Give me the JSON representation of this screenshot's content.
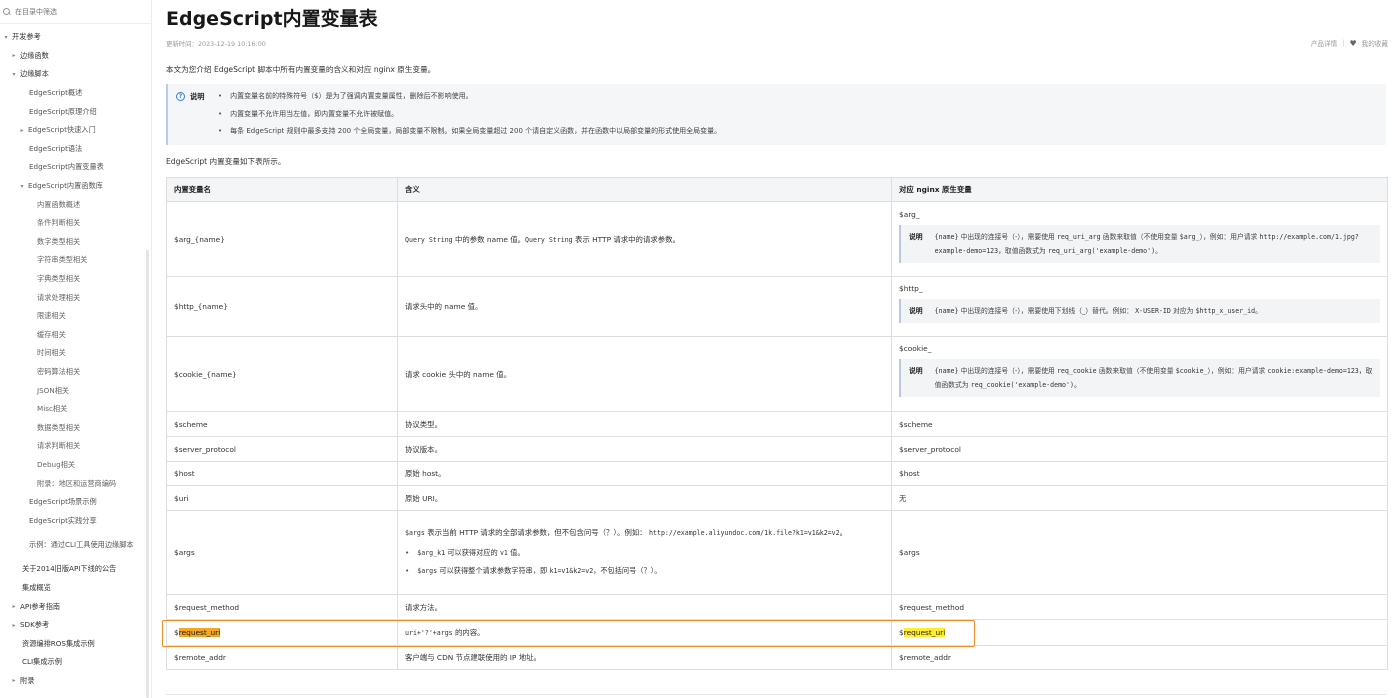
{
  "sidebar": {
    "search_placeholder": "在目录中筛选",
    "items": [
      {
        "label": "开发参考",
        "toggle": "▾"
      },
      {
        "label": "边缘函数",
        "toggle": "▸"
      },
      {
        "label": "边缘脚本",
        "toggle": "▾"
      },
      {
        "label": "EdgeScript概述",
        "toggle": ""
      },
      {
        "label": "EdgeScript原理介绍",
        "toggle": ""
      },
      {
        "label": "EdgeScript快速入门",
        "toggle": "▸"
      },
      {
        "label": "EdgeScript语法",
        "toggle": ""
      },
      {
        "label": "EdgeScript内置变量表",
        "toggle": ""
      },
      {
        "label": "EdgeScript内置函数库",
        "toggle": "▾"
      },
      {
        "label": "内置函数概述",
        "toggle": ""
      },
      {
        "label": "条件判断相关",
        "toggle": ""
      },
      {
        "label": "数字类型相关",
        "toggle": ""
      },
      {
        "label": "字符串类型相关",
        "toggle": ""
      },
      {
        "label": "字典类型相关",
        "toggle": ""
      },
      {
        "label": "请求处理相关",
        "toggle": ""
      },
      {
        "label": "限速相关",
        "toggle": ""
      },
      {
        "label": "缓存相关",
        "toggle": ""
      },
      {
        "label": "时间相关",
        "toggle": ""
      },
      {
        "label": "密码算法相关",
        "toggle": ""
      },
      {
        "label": "JSON相关",
        "toggle": ""
      },
      {
        "label": "Misc相关",
        "toggle": ""
      },
      {
        "label": "数据类型相关",
        "toggle": ""
      },
      {
        "label": "请求判断相关",
        "toggle": ""
      },
      {
        "label": "Debug相关",
        "toggle": ""
      },
      {
        "label": "附录：地区和运营商编码",
        "toggle": ""
      },
      {
        "label": "EdgeScript场景示例",
        "toggle": ""
      },
      {
        "label": "EdgeScript实践分享",
        "toggle": ""
      },
      {
        "label": "示例：通过CLI工具使用边缘脚本",
        "toggle": ""
      },
      {
        "label": "关于2014旧版API下线的公告",
        "toggle": ""
      },
      {
        "label": "集成概览",
        "toggle": ""
      },
      {
        "label": "API参考指南",
        "toggle": "▸"
      },
      {
        "label": "SDK参考",
        "toggle": "▸"
      },
      {
        "label": "资源编排ROS集成示例",
        "toggle": ""
      },
      {
        "label": "CLI集成示例",
        "toggle": ""
      },
      {
        "label": "附录",
        "toggle": "▸"
      }
    ]
  },
  "page": {
    "title": "EdgeScript内置变量表",
    "updated": "更新时间：2023-12-19 10:16:00",
    "product_detail": "产品详情",
    "separator": "|",
    "favorite": "我的收藏",
    "intro": "本文为您介绍 EdgeScript 脚本中所有内置变量的含义和对应 nginx 原生变量。",
    "note": {
      "icon": "?",
      "label": "说明",
      "items": [
        "内置变量名前的特殊符号（$）是为了强调内置变量属性，删除后不影响使用。",
        "内置变量不允许用当左值，即内置变量不允许被赋值。",
        "每条 EdgeScript 规则中最多支持 200 个全局变量，局部变量不限制。如果全局变量超过 200 个请自定义函数，并在函数中以局部变量的形式使用全局变量。"
      ]
    },
    "lead": "EdgeScript 内置变量如下表所示。"
  },
  "table": {
    "headers": [
      "内置变量名",
      "含义",
      "对应 nginx 原生变量"
    ],
    "note_label": "说明",
    "rows": {
      "arg": {
        "name": "$arg_{name}",
        "m1": "Query String",
        "m2": " 中的参数 name 值。",
        "m3": "Query String",
        "m4": " 表示 HTTP 请求中的请求参数。",
        "ng": "$arg_",
        "n1": "{name}",
        "n2": " 中出现的连接号（-），需要使用 ",
        "n3": "req_uri_arg",
        "n4": " 函数来取值（不使用变量 ",
        "n5": "$arg_",
        "n6": "），例如：用户请求 ",
        "n7": "http://example.com/1.jpg?example-demo=123",
        "n8": "，取值函数式为 ",
        "n9": "req_uri_arg('example-demo')",
        "n10": "。"
      },
      "http": {
        "name": "$http_{name}",
        "meaning": "请求头中的 name 值。",
        "ng": "$http_",
        "n1": "{name}",
        "n2": " 中出现的连接号（-），需要使用下划线（_）替代。例如： ",
        "n3": "X-USER-ID",
        "n4": " 对应为 ",
        "n5": "$http_x_user_id",
        "n6": "。"
      },
      "cookie": {
        "name": "$cookie_{name}",
        "meaning": "请求 cookie 头中的 name 值。",
        "ng": "$cookie_",
        "n1": "{name}",
        "n2": " 中出现的连接号（-），需要使用 ",
        "n3": "req_cookie",
        "n4": " 函数来取值（不使用变量 ",
        "n5": "$cookie_",
        "n6": "），例如：用户请求 ",
        "n7": "cookie:example-demo=123",
        "n8": "，取值函数式为 ",
        "n9": "req_cookie('example-demo')",
        "n10": "。"
      },
      "scheme": {
        "name": "$scheme",
        "meaning": "协议类型。",
        "ng": "$scheme"
      },
      "server_protocol": {
        "name": "$server_protocol",
        "meaning": "协议版本。",
        "ng": "$server_protocol"
      },
      "host": {
        "name": "$host",
        "meaning": "原始 host。",
        "ng": "$host"
      },
      "uri": {
        "name": "$uri",
        "meaning": "原始 URI。",
        "ng": "无"
      },
      "args": {
        "name": "$args",
        "m1": "$args",
        "m2": " 表示当前 HTTP 请求的全部请求参数，但不包含问号（？）。例如： ",
        "m3": "http://example.aliyundoc.com/1k.file?k1=v1&k2=v2",
        "m4": "。",
        "b1a": "$arg_k1",
        "b1b": " 可以获得对应的 ",
        "b1c": "v1",
        "b1d": " 值。",
        "b2a": "$args",
        "b2b": " 可以获得整个请求参数字符串，即 ",
        "b2c": "k1=v1&k2=v2",
        "b2d": "，不包括问号（？）。",
        "ng": "$args"
      },
      "request_method": {
        "name": "$request_method",
        "meaning": "请求方法。",
        "ng": "$request_method"
      },
      "request_uri": {
        "name_prefix": "$",
        "name_hl": "request_uri",
        "m1": "uri+'?'+args",
        "m2": " 的内容。",
        "ng_prefix": "$",
        "ng_hl": "request_uri"
      },
      "remote_addr": {
        "name": "$remote_addr",
        "meaning": "客户端与 CDN 节点建联使用的 IP 地址。",
        "ng": "$remote_addr"
      }
    }
  }
}
